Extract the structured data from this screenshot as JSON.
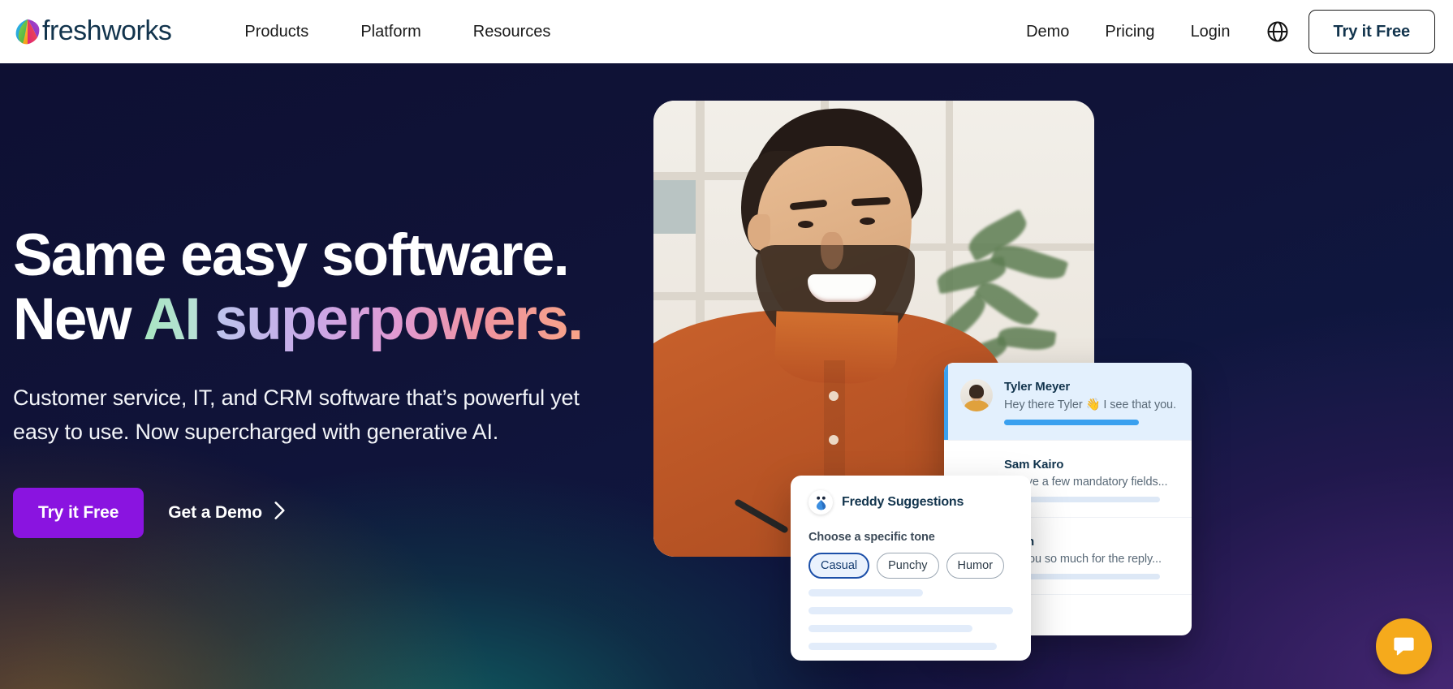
{
  "navbar": {
    "brand_name": "freshworks",
    "brand_logo_icon": "freshworks-leaf-logo",
    "left_items": [
      {
        "label": "Products"
      },
      {
        "label": "Platform"
      },
      {
        "label": "Resources"
      }
    ],
    "right_items": [
      {
        "label": "Demo"
      },
      {
        "label": "Pricing"
      },
      {
        "label": "Login"
      }
    ],
    "globe_icon": "globe-icon",
    "cta_label": "Try it Free"
  },
  "hero": {
    "headline_line1": "Same easy software.",
    "headline_line2_prefix": "New ",
    "headline_line2_ai": "AI",
    "headline_line2_space": " ",
    "headline_line2_super": "superpowers.",
    "subhead_line1": "Customer service, IT, and CRM software that’s powerful yet",
    "subhead_line2": "easy to use. Now supercharged with generative AI.",
    "primary_cta": "Try it Free",
    "secondary_cta": "Get a Demo",
    "secondary_cta_icon": "chevron-right-icon",
    "photo_alt": "smiling-man-in-orange-shirt-at-desk"
  },
  "chat_card": {
    "rows": [
      {
        "name": "Tyler Meyer",
        "message": "Hey there Tyler 👋 I see that you...",
        "state": "active"
      },
      {
        "name": "Sam Kairo",
        "message": "...have a few mandatory fields...",
        "state": "dim"
      },
      {
        "name": "Chen",
        "message": "...k you so much for the reply...",
        "state": "dim"
      }
    ]
  },
  "freddy": {
    "icon": "freddy-bot-icon",
    "title": "Freddy Suggestions",
    "tone_label": "Choose a specific tone",
    "tones": [
      {
        "label": "Casual",
        "selected": true
      },
      {
        "label": "Punchy",
        "selected": false
      },
      {
        "label": "Humor",
        "selected": false
      }
    ],
    "skeleton_widths": [
      "56%",
      "100%",
      "80%",
      "92%"
    ]
  },
  "fab": {
    "icon": "chat-bubble-icon",
    "color": "#f5aa1c"
  },
  "colors": {
    "accent_purple": "#8a14e0",
    "hero_bg_navy": "#10123a",
    "brand_dark": "#12344d",
    "chat_blue": "#3aa0ef",
    "fab_amber": "#f5aa1c"
  }
}
